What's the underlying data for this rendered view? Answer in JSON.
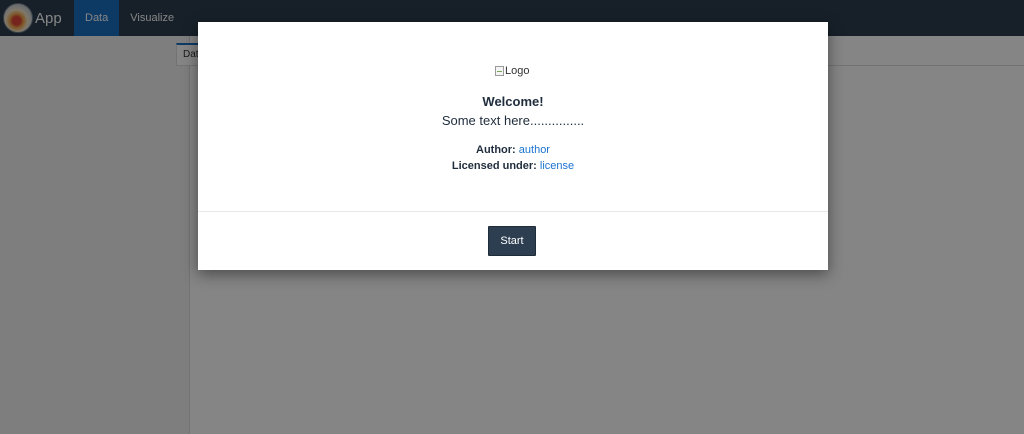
{
  "navbar": {
    "brand": "App",
    "items": [
      {
        "label": "Data",
        "active": true
      },
      {
        "label": "Visualize",
        "active": false
      }
    ]
  },
  "content": {
    "active_tab_label": "Data"
  },
  "modal": {
    "logo_alt": "Logo",
    "title": "Welcome!",
    "text": "Some text here...............",
    "author_label": "Author:",
    "author_link": "author",
    "license_label": "Licensed under:",
    "license_link": "license",
    "start_label": "Start"
  },
  "colors": {
    "navbar_bg": "#2c3e50",
    "accent": "#1a6fc2",
    "link": "#1a73d1",
    "button_bg": "#2c3e50"
  }
}
